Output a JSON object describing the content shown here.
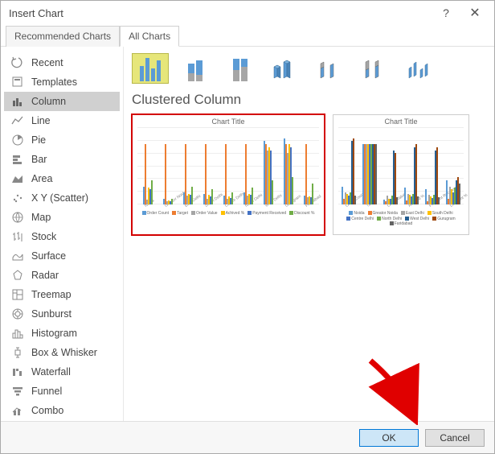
{
  "titlebar": {
    "title": "Insert Chart",
    "help": "?",
    "close": "✕"
  },
  "tabs": {
    "recommended": "Recommended Charts",
    "all": "All Charts"
  },
  "sidebar": {
    "items": [
      {
        "label": "Recent"
      },
      {
        "label": "Templates"
      },
      {
        "label": "Column"
      },
      {
        "label": "Line"
      },
      {
        "label": "Pie"
      },
      {
        "label": "Bar"
      },
      {
        "label": "Area"
      },
      {
        "label": "X Y (Scatter)"
      },
      {
        "label": "Map"
      },
      {
        "label": "Stock"
      },
      {
        "label": "Surface"
      },
      {
        "label": "Radar"
      },
      {
        "label": "Treemap"
      },
      {
        "label": "Sunburst"
      },
      {
        "label": "Histogram"
      },
      {
        "label": "Box & Whisker"
      },
      {
        "label": "Waterfall"
      },
      {
        "label": "Funnel"
      },
      {
        "label": "Combo"
      }
    ]
  },
  "content": {
    "chart_type_label": "Clustered Column",
    "preview_title": "Chart Title"
  },
  "chart_data": [
    {
      "type": "bar",
      "title": "Chart Title",
      "categories": [
        "Noida",
        "Greator Noida",
        "East Delhi",
        "South Delhi",
        "Centre Delhi",
        "North Delhi",
        "West Delhi",
        "Gurugram",
        "Faridabad"
      ],
      "series": [
        {
          "name": "Order Count",
          "color": "#5b9bd5",
          "values": [
            300000,
            90000,
            200000,
            180000,
            150000,
            200000,
            1050000,
            1100000,
            150000
          ]
        },
        {
          "name": "Target",
          "color": "#ed7d31",
          "values": [
            1000000,
            1000000,
            1000000,
            1000000,
            1000000,
            1000000,
            1000000,
            1000000,
            1000000
          ]
        },
        {
          "name": "Order Value",
          "color": "#a5a5a5",
          "values": [
            80000,
            60000,
            150000,
            100000,
            100000,
            150000,
            900000,
            850000,
            120000
          ]
        },
        {
          "name": "Achived %",
          "color": "#ffc000",
          "values": [
            280000,
            70000,
            180000,
            160000,
            130000,
            180000,
            950000,
            1000000,
            130000
          ]
        },
        {
          "name": "Payment Received",
          "color": "#4472c4",
          "values": [
            250000,
            60000,
            160000,
            140000,
            110000,
            160000,
            900000,
            950000,
            120000
          ]
        },
        {
          "name": "Discount %",
          "color": "#70ad47",
          "values": [
            400000,
            100000,
            300000,
            250000,
            200000,
            280000,
            400000,
            450000,
            350000
          ]
        }
      ],
      "ylim": [
        0,
        1200000
      ],
      "yticks": [
        0,
        200000,
        400000,
        600000,
        800000,
        1000000,
        1200000
      ]
    },
    {
      "type": "bar",
      "title": "Chart Title",
      "categories": [
        "Order Count",
        "Target",
        "Order Value",
        "Achived %",
        "Payment Received",
        "Discount %"
      ],
      "series": [
        {
          "name": "Noida",
          "color": "#5b9bd5",
          "values": [
            300000,
            1000000,
            80000,
            280000,
            250000,
            400000
          ]
        },
        {
          "name": "Greator Noida",
          "color": "#ed7d31",
          "values": [
            90000,
            1000000,
            60000,
            70000,
            60000,
            100000
          ]
        },
        {
          "name": "East Delhi",
          "color": "#a5a5a5",
          "values": [
            200000,
            1000000,
            150000,
            180000,
            160000,
            300000
          ]
        },
        {
          "name": "South Delhi",
          "color": "#ffc000",
          "values": [
            180000,
            1000000,
            100000,
            160000,
            140000,
            250000
          ]
        },
        {
          "name": "Centre Delhi",
          "color": "#4472c4",
          "values": [
            150000,
            1000000,
            100000,
            130000,
            110000,
            200000
          ]
        },
        {
          "name": "North Delhi",
          "color": "#70ad47",
          "values": [
            200000,
            1000000,
            150000,
            180000,
            160000,
            280000
          ]
        },
        {
          "name": "West Delhi",
          "color": "#255e91",
          "values": [
            1050000,
            1000000,
            900000,
            950000,
            900000,
            400000
          ]
        },
        {
          "name": "Gurugram",
          "color": "#9e480e",
          "values": [
            1100000,
            1000000,
            850000,
            1000000,
            950000,
            450000
          ]
        },
        {
          "name": "Faridabad",
          "color": "#636363",
          "values": [
            150000,
            1000000,
            120000,
            130000,
            120000,
            350000
          ]
        }
      ],
      "ylim": [
        0,
        1200000
      ],
      "yticks": [
        0,
        200000,
        400000,
        600000,
        800000,
        1000000,
        1200000
      ]
    }
  ],
  "buttons": {
    "ok": "OK",
    "cancel": "Cancel"
  }
}
